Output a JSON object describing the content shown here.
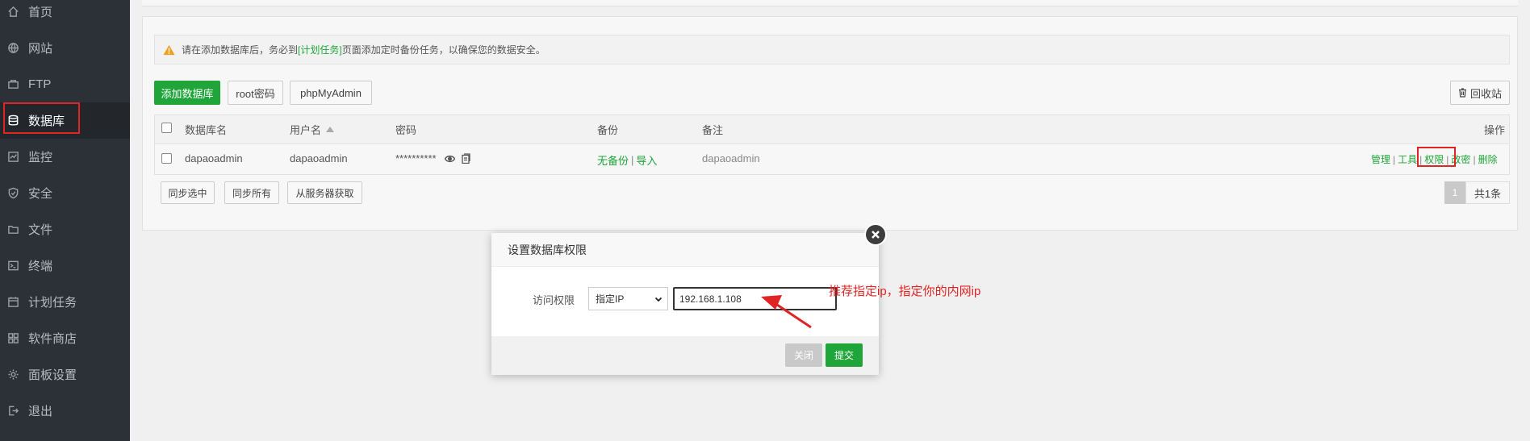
{
  "sidebar": {
    "items": [
      {
        "label": "首页",
        "icon": "home-icon"
      },
      {
        "label": "网站",
        "icon": "globe-icon"
      },
      {
        "label": "FTP",
        "icon": "ftp-icon"
      },
      {
        "label": "数据库",
        "icon": "database-icon"
      },
      {
        "label": "监控",
        "icon": "monitor-icon"
      },
      {
        "label": "安全",
        "icon": "shield-icon"
      },
      {
        "label": "文件",
        "icon": "folder-icon"
      },
      {
        "label": "终端",
        "icon": "terminal-icon"
      },
      {
        "label": "计划任务",
        "icon": "calendar-icon"
      },
      {
        "label": "软件商店",
        "icon": "apps-icon"
      },
      {
        "label": "面板设置",
        "icon": "gear-icon"
      },
      {
        "label": "退出",
        "icon": "logout-icon"
      }
    ],
    "active_index": 3
  },
  "notice": {
    "before": "请在添加数据库后，务必到",
    "link": "[计划任务]",
    "after": "页面添加定时备份任务，以确保您的数据安全。"
  },
  "toolbar": {
    "add_db": "添加数据库",
    "root_pwd": "root密码",
    "phpmyadmin": "phpMyAdmin",
    "recycle": "回收站"
  },
  "table": {
    "headers": {
      "name": "数据库名",
      "user": "用户名",
      "password": "密码",
      "backup": "备份",
      "note": "备注",
      "actions": "操作"
    },
    "rows": [
      {
        "name": "dapaoadmin",
        "user": "dapaoadmin",
        "password": "**********",
        "backup_none": "无备份",
        "backup_import": "导入",
        "note": "dapaoadmin"
      }
    ],
    "row_actions": {
      "manage": "管理",
      "tools": "工具",
      "perm": "权限",
      "chpwd": "改密",
      "delete": "删除"
    }
  },
  "footer_buttons": {
    "sync_selected": "同步选中",
    "sync_all": "同步所有",
    "from_server": "从服务器获取"
  },
  "pager": {
    "current": "1",
    "total": "共1条"
  },
  "modal": {
    "title": "设置数据库权限",
    "label": "访问权限",
    "select_value": "指定IP",
    "ip_value": "192.168.1.108",
    "close": "关闭",
    "submit": "提交"
  },
  "annotation": {
    "text": "推荐指定ip，指定你的内网ip"
  },
  "colors": {
    "accent": "#20a53a",
    "highlight": "#e02424",
    "sidebar": "#2c3138"
  }
}
